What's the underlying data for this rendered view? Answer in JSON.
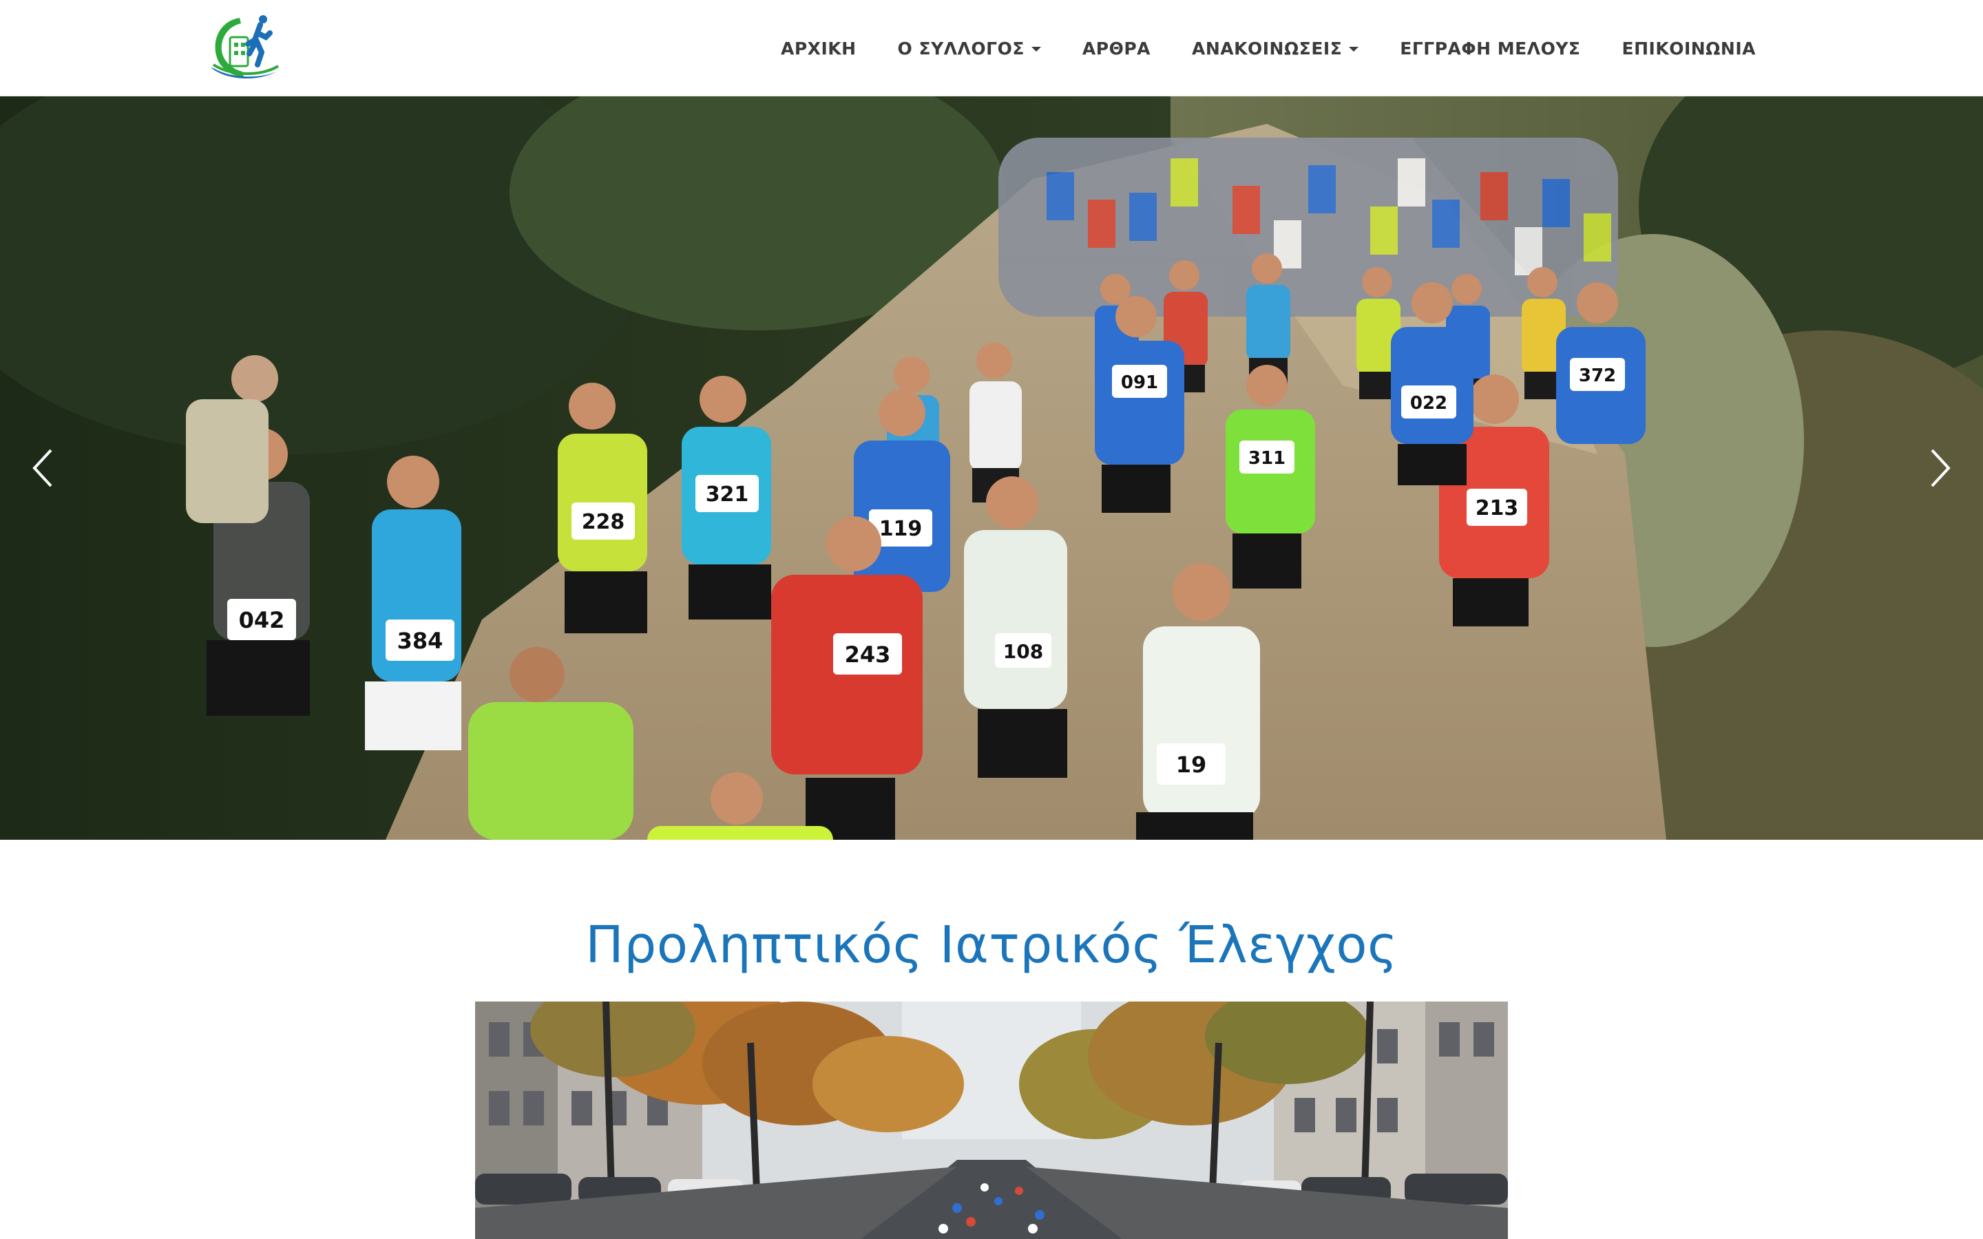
{
  "header": {
    "logo_icon": "runner-logo-icon",
    "nav": [
      {
        "label": "ΑΡΧΙΚΗ",
        "dropdown": false
      },
      {
        "label": "Ο ΣΥΛΛΟΓΟΣ",
        "dropdown": true
      },
      {
        "label": "ΑΡΘΡΑ",
        "dropdown": false
      },
      {
        "label": "ΑΝΑΚΟΙΝΩΣΕΙΣ",
        "dropdown": true
      },
      {
        "label": "ΕΓΓΡΑΦΗ ΜΕΛΟΥΣ",
        "dropdown": false
      },
      {
        "label": "ΕΠΙΚΟΙΝΩΝΙΑ",
        "dropdown": false
      }
    ]
  },
  "hero": {
    "prev_icon": "chevron-left-icon",
    "next_icon": "chevron-right-icon",
    "bibs": [
      "042",
      "384",
      "228",
      "321",
      "119",
      "243",
      "108",
      "19",
      "213",
      "372",
      "022",
      "091",
      "311"
    ]
  },
  "article": {
    "title": "Προληπτικός Ιατρικός Έλεγχος"
  },
  "colors": {
    "title_blue": "#1b75bb",
    "nav_text": "#3b3b3b",
    "logo_green": "#2eaa3c",
    "logo_blue": "#1c6fb7"
  }
}
